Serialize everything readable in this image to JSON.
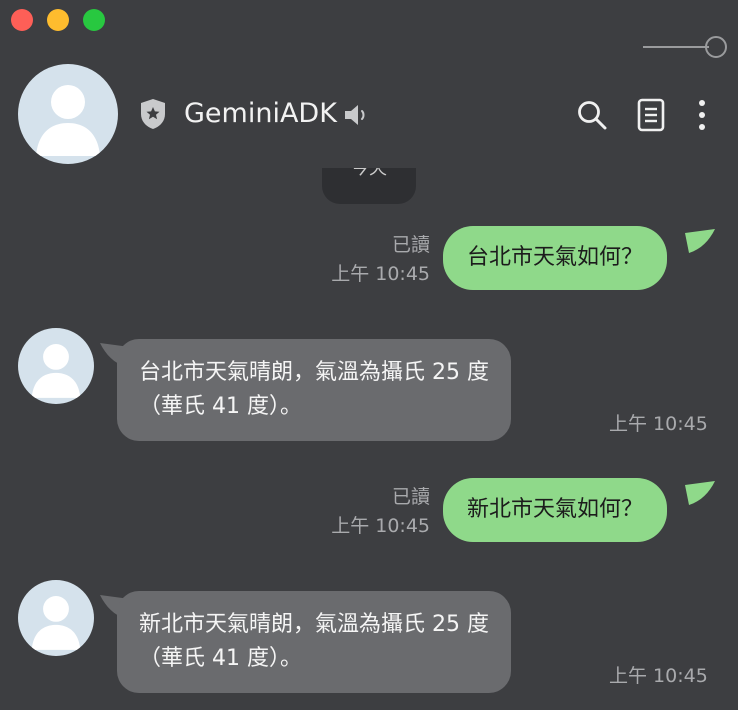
{
  "window": {
    "controls": [
      "close",
      "minimize",
      "zoom"
    ]
  },
  "header": {
    "name": "GeminiADK",
    "icons": [
      "shield-star-icon",
      "speaker-icon",
      "search-icon",
      "notes-icon",
      "more-icon"
    ]
  },
  "date_chip": "今天",
  "messages": [
    {
      "direction": "out",
      "text": "台北市天氣如何？",
      "read": "已讀",
      "time": "上午 10:45"
    },
    {
      "direction": "in",
      "line1": "台北市天氣晴朗，氣溫為攝氏 25 度",
      "line2": "（華氏 41 度）。",
      "time": "上午 10:45"
    },
    {
      "direction": "out",
      "text": "新北市天氣如何？",
      "read": "已讀",
      "time": "上午 10:45"
    },
    {
      "direction": "in",
      "line1": "新北市天氣晴朗，氣溫為攝氏 25 度",
      "line2": "（華氏 41 度）。",
      "time": "上午 10:45"
    }
  ],
  "colors": {
    "background": "#3d3e41",
    "outgoing_bubble": "#8fd98a",
    "incoming_bubble": "#6a6b6e",
    "meta_text": "#a9aaad"
  }
}
